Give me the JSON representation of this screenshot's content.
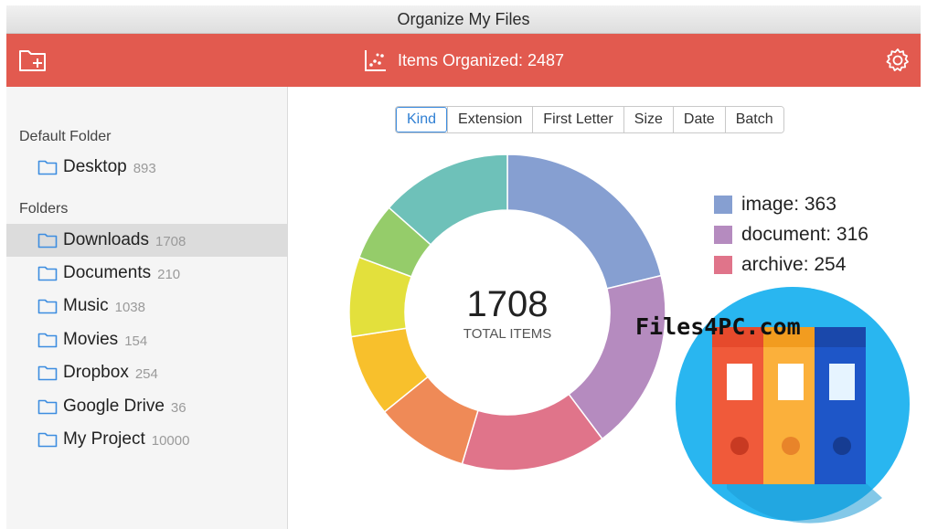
{
  "window": {
    "title": "Organize My Files"
  },
  "toolbar": {
    "status_label": "Items Organized: 2487",
    "new_folder_icon": "folder-plus-icon",
    "chart_icon": "scatter-chart-icon",
    "settings_icon": "gear-icon",
    "bg_color": "#e25a4f"
  },
  "sidebar": {
    "default_heading": "Default Folder",
    "default_items": [
      {
        "name": "Desktop",
        "count": "893"
      }
    ],
    "folders_heading": "Folders",
    "folders": [
      {
        "name": "Downloads",
        "count": "1708",
        "selected": true
      },
      {
        "name": "Documents",
        "count": "210"
      },
      {
        "name": "Music",
        "count": "1038"
      },
      {
        "name": "Movies",
        "count": "154"
      },
      {
        "name": "Dropbox",
        "count": "254"
      },
      {
        "name": "Google Drive",
        "count": "36"
      },
      {
        "name": "My Project",
        "count": "10000"
      }
    ]
  },
  "tabs": [
    {
      "label": "Kind",
      "active": true
    },
    {
      "label": "Extension"
    },
    {
      "label": "First Letter"
    },
    {
      "label": "Size"
    },
    {
      "label": "Date"
    },
    {
      "label": "Batch"
    }
  ],
  "chart_center": {
    "value": "1708",
    "label": "TOTAL ITEMS"
  },
  "legend": [
    {
      "label": "image: 363",
      "color": "#869fd1"
    },
    {
      "label": "document: 316",
      "color": "#b58bbf"
    },
    {
      "label": "archive: 254",
      "color": "#e0748a"
    }
  ],
  "chart_data": {
    "type": "pie",
    "total": 1708,
    "slices": [
      {
        "name": "image",
        "value": 363,
        "color": "#869fd1"
      },
      {
        "name": "document",
        "value": 316,
        "color": "#b58bbf"
      },
      {
        "name": "archive",
        "value": 254,
        "color": "#e0748a"
      },
      {
        "value": 163,
        "color": "#ef8a57"
      },
      {
        "value": 143,
        "color": "#f8c02c"
      },
      {
        "value": 139,
        "color": "#e3e03c"
      },
      {
        "value": 100,
        "color": "#95cc6a"
      },
      {
        "value": 230,
        "color": "#6ec1b9"
      }
    ]
  },
  "watermark": "Files4PC.com"
}
